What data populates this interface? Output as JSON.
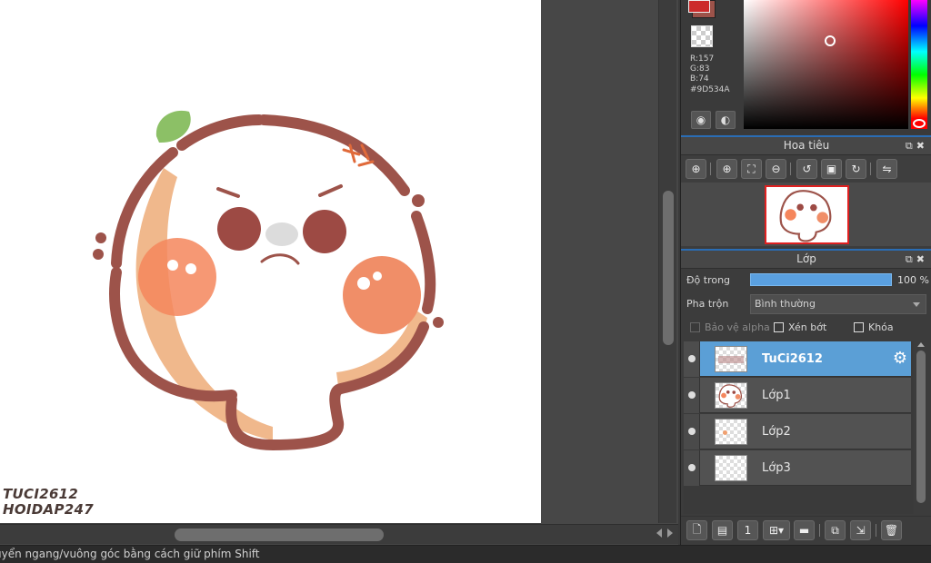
{
  "canvas": {
    "watermark_lines": [
      "TUCI2612",
      "HOIDAP247"
    ]
  },
  "status_bar": {
    "text": "uyển ngang/vuông góc bằng cách giữ phím Shift"
  },
  "color_panel": {
    "foreground_color": "#CC2B2B",
    "background_color": "#9D534A",
    "r": "R:157",
    "g": "G:83",
    "b": "B:74",
    "hex": "#9D534A"
  },
  "navigator_panel": {
    "title": "Hoa tiêu"
  },
  "layer_panel": {
    "title": "Lớp",
    "opacity_label": "Độ trong",
    "opacity_value": "100 %",
    "opacity_fraction": 1.0,
    "blend_label": "Pha trộn",
    "blend_value": "Bình thường",
    "protect_alpha_label": "Bảo vệ alpha",
    "clipping_label": "Xén bớt",
    "lock_label": "Khóa",
    "layers": [
      {
        "name": "TuCi2612",
        "active": true
      },
      {
        "name": "Lớp1",
        "active": false
      },
      {
        "name": "Lớp2",
        "active": false
      },
      {
        "name": "Lớp3",
        "active": false
      }
    ]
  },
  "icons": {
    "navigator_tools": [
      "zoom-fit-icon",
      "zoom-in-icon",
      "fit-window-icon",
      "zoom-out-icon",
      "rotate-left-icon",
      "reset-view-icon",
      "rotate-right-icon",
      "flip-icon"
    ],
    "layer_tools": [
      "new-layer-icon",
      "new-halftone-layer-icon",
      "new-1bit-layer-icon",
      "add-layer-dropdown-icon",
      "new-folder-icon",
      "duplicate-layer-icon",
      "merge-layer-icon",
      "delete-layer-icon"
    ]
  }
}
